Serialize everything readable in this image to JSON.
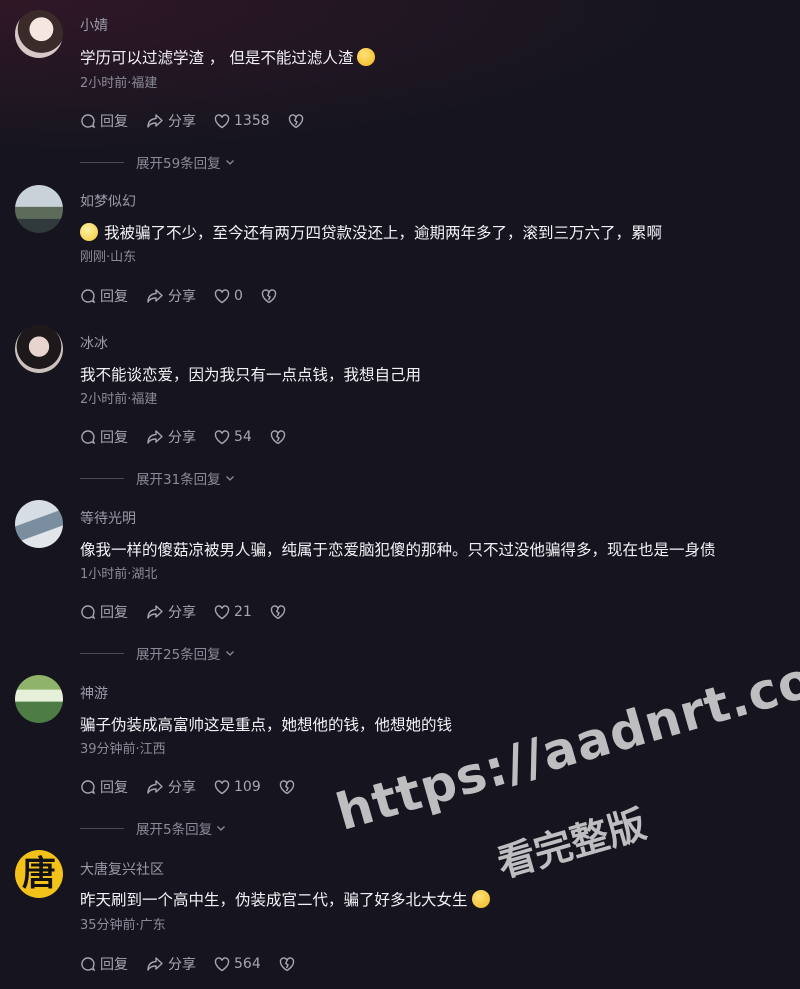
{
  "actions": {
    "reply": "回复",
    "share": "分享"
  },
  "comments": [
    {
      "name": "小婧",
      "text": "学历可以过滤学渣 ， 但是不能过滤人渣",
      "meta": "2小时前·福建",
      "likes": "1358",
      "expand": "展开59条回复"
    },
    {
      "name": "如梦似幻",
      "text": "我被骗了不少，至今还有两万四贷款没还上，逾期两年多了，滚到三万六了，累啊",
      "meta": "刚刚·山东",
      "likes": "0",
      "expand": ""
    },
    {
      "name": "冰冰",
      "text": "我不能谈恋爱，因为我只有一点点钱，我想自己用",
      "meta": "2小时前·福建",
      "likes": "54",
      "expand": "展开31条回复"
    },
    {
      "name": "等待光明",
      "text": "像我一样的傻菇凉被男人骗，纯属于恋爱脑犯傻的那种。只不过没他骗得多，现在也是一身债",
      "meta": "1小时前·湖北",
      "likes": "21",
      "expand": "展开25条回复"
    },
    {
      "name": "神游",
      "text": "骗子伪装成高富帅这是重点，她想他的钱，他想她的钱",
      "meta": "39分钟前·江西",
      "likes": "109",
      "expand": "展开5条回复"
    },
    {
      "name": "大唐复兴社区",
      "avatar_text": "唐",
      "text": "昨天刷到一个高中生，伪装成官二代，骗了好多北大女生",
      "meta": "35分钟前·广东",
      "likes": "564",
      "expand": ""
    }
  ],
  "watermark": {
    "url": "https://aadnrt.com",
    "tagline": "看完整版"
  }
}
